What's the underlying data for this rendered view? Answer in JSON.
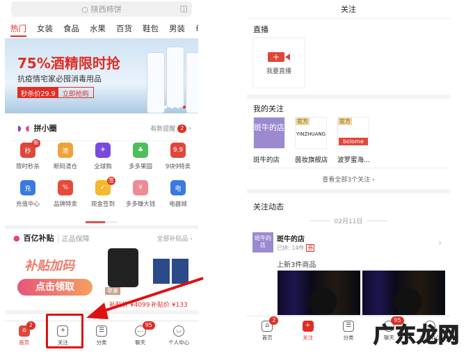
{
  "left": {
    "search_placeholder": "陕西柿饼",
    "tabs": [
      "热门",
      "女装",
      "食品",
      "水果",
      "百货",
      "鞋包",
      "男装",
      "母婴"
    ],
    "banner": {
      "headline": "75%酒精限时抢",
      "subline": "抗疫情宅家必囤消毒用品",
      "price": "秒杀价29.9",
      "cta": "立即抢购"
    },
    "pin": {
      "title": "拼小圈",
      "reminder": "有新提醒",
      "count": "2"
    },
    "icons": [
      {
        "label": "限时秒杀",
        "glyph": "秒",
        "color": "#e0463a",
        "tag": "新"
      },
      {
        "label": "断码清仓",
        "glyph": "清",
        "color": "#f0a23a"
      },
      {
        "label": "全球购",
        "glyph": "✈",
        "color": "#7a4ae0"
      },
      {
        "label": "多多果园",
        "glyph": "♣",
        "color": "#4cbf5a"
      },
      {
        "label": "9块9特卖",
        "glyph": "9.9",
        "color": "#e0463a"
      },
      {
        "label": "充值中心",
        "glyph": "充",
        "color": "#3a7ae0"
      },
      {
        "label": "品牌特卖",
        "glyph": "%",
        "color": "#e84a3a"
      },
      {
        "label": "现金签到",
        "glyph": "✓",
        "color": "#f5b82e",
        "tag": "签"
      },
      {
        "label": "多多赚大钱",
        "glyph": "¥",
        "color": "#ef8a94"
      },
      {
        "label": "电器城",
        "glyph": "电",
        "color": "#3a7ae0"
      }
    ],
    "subsidy": {
      "title": "百亿补贴",
      "tagline": "正品保障",
      "all": "全部补贴品 ›",
      "promo1": "补贴加码",
      "promo2": "点击领取",
      "item1_tag": "苹果",
      "item1_price": "补贴价 ¥4099",
      "item2_price": "补贴价 ¥133"
    },
    "tabbar": [
      {
        "label": "首页",
        "badge": "2"
      },
      {
        "label": "关注"
      },
      {
        "label": "分类"
      },
      {
        "label": "聊天",
        "badge": "95"
      },
      {
        "label": "个人中心"
      }
    ]
  },
  "right": {
    "title": "关注",
    "live_section": "直播",
    "live_button": "我要直播",
    "follow_section": "我的关注",
    "stores": [
      {
        "name": "斑牛的店",
        "logo": "斑牛的店"
      },
      {
        "name": "茵妆旗舰店",
        "logo": "YINZHUANG",
        "official": "官方"
      },
      {
        "name": "波罗蜜海...",
        "logo": "bolome",
        "official": "官方"
      }
    ],
    "view_all": "查看全部3个关注 ›",
    "feed_section": "关注动态",
    "date": "02月11日",
    "feed": {
      "store": "斑牛的店",
      "avatar": "斑牛的店",
      "stats": "已拼: 14件",
      "coupon": "券",
      "update": "上新3件商品"
    },
    "tabbar": [
      {
        "label": "首页",
        "badge": "2"
      },
      {
        "label": "关注"
      },
      {
        "label": "分类"
      },
      {
        "label": "聊天",
        "badge": "95"
      },
      {
        "label": "个人中心"
      }
    ]
  },
  "watermark": "广东龙网",
  "colors": {
    "accent": "#e02e24"
  }
}
